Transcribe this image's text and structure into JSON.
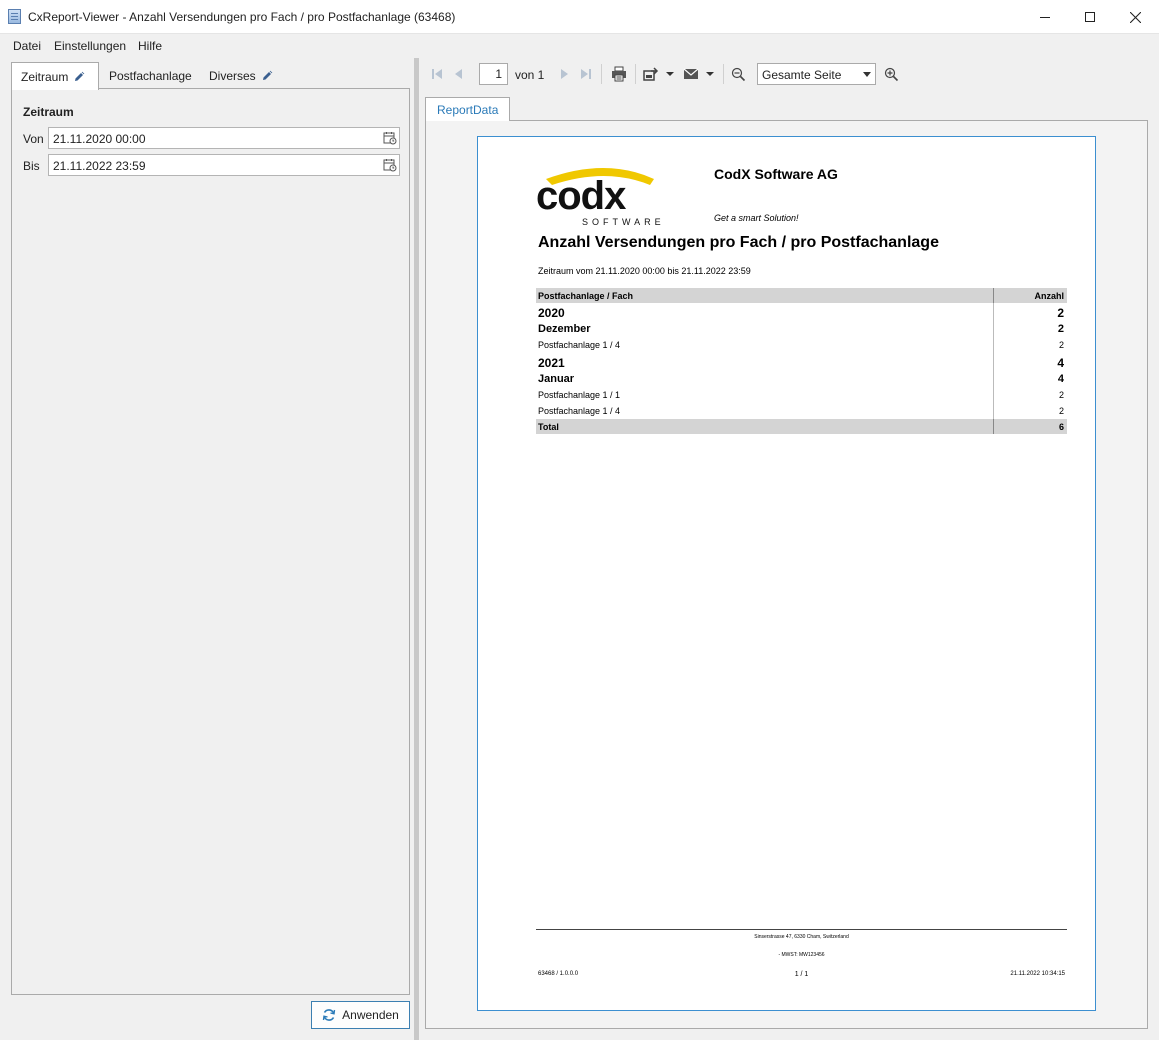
{
  "window": {
    "title": "CxReport-Viewer - Anzahl Versendungen pro Fach / pro Postfachanlage (63468)"
  },
  "menu": {
    "items": [
      "Datei",
      "Einstellungen",
      "Hilfe"
    ]
  },
  "left_tabs": [
    {
      "label": "Zeitraum",
      "icon": "pencil-icon"
    },
    {
      "label": "Postfachanlage"
    },
    {
      "label": "Diverses",
      "icon": "pencil-icon"
    }
  ],
  "zeitraum": {
    "section_title": "Zeitraum",
    "from_label": "Von",
    "from_value": "21.11.2020 00:00",
    "to_label": "Bis",
    "to_value": "21.11.2022 23:59"
  },
  "apply_button": {
    "label": "Anwenden",
    "icon": "refresh-icon"
  },
  "toolbar": {
    "current_page": "1",
    "of_text": "von 1",
    "zoom_value": "Gesamte Seite"
  },
  "report_tab": {
    "label": "ReportData"
  },
  "report": {
    "company": "CodX Software AG",
    "slogan": "Get a smart Solution!",
    "title": "Anzahl Versendungen pro Fach / pro Postfachanlage",
    "period": "Zeitraum vom 21.11.2020 00:00 bis 21.11.2022 23:59",
    "logo_text": "codx",
    "logo_sub": "SOFTWARE",
    "columns": [
      "Postfachanlage / Fach",
      "Anzahl"
    ],
    "rows": [
      {
        "kind": "year",
        "label": "2020",
        "value": "2"
      },
      {
        "kind": "month",
        "label": "Dezember",
        "value": "2"
      },
      {
        "kind": "item",
        "label": "Postfachanlage 1 / 4",
        "value": "2"
      },
      {
        "kind": "year",
        "label": "2021",
        "value": "4"
      },
      {
        "kind": "month",
        "label": "Januar",
        "value": "4"
      },
      {
        "kind": "item",
        "label": "Postfachanlage 1 / 1",
        "value": "2"
      },
      {
        "kind": "item",
        "label": "Postfachanlage 1 / 4",
        "value": "2"
      }
    ],
    "total": {
      "label": "Total",
      "value": "6"
    },
    "footer": {
      "address": "Sinserstrasse 47, 6330 Cham, Switzerland",
      "vat": "- MWST: MW123456",
      "version": "63468 / 1.0.0.0",
      "page": "1 / 1",
      "timestamp": "21.11.2022 10:34:15"
    }
  },
  "colors": {
    "accent": "#2a7ab8",
    "page_border": "#3c8fd0",
    "logo_yellow": "#f0c800"
  }
}
